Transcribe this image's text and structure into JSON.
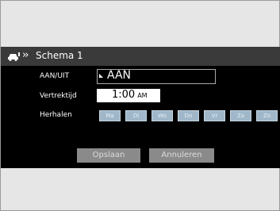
{
  "header": {
    "title": "Schema 1"
  },
  "fields": {
    "aan_uit_label": "AAN/UIT",
    "aan_uit_value": "AAN",
    "vertrektijd_label": "Vertrektijd",
    "time_value": "1:00",
    "time_ampm": "AM",
    "herhalen_label": "Herhalen"
  },
  "days": [
    "Ma",
    "Di",
    "Wo",
    "Do",
    "Vr",
    "Za",
    "Zo"
  ],
  "buttons": {
    "save_label": "Opslaan",
    "cancel_label": "Annuleren"
  }
}
